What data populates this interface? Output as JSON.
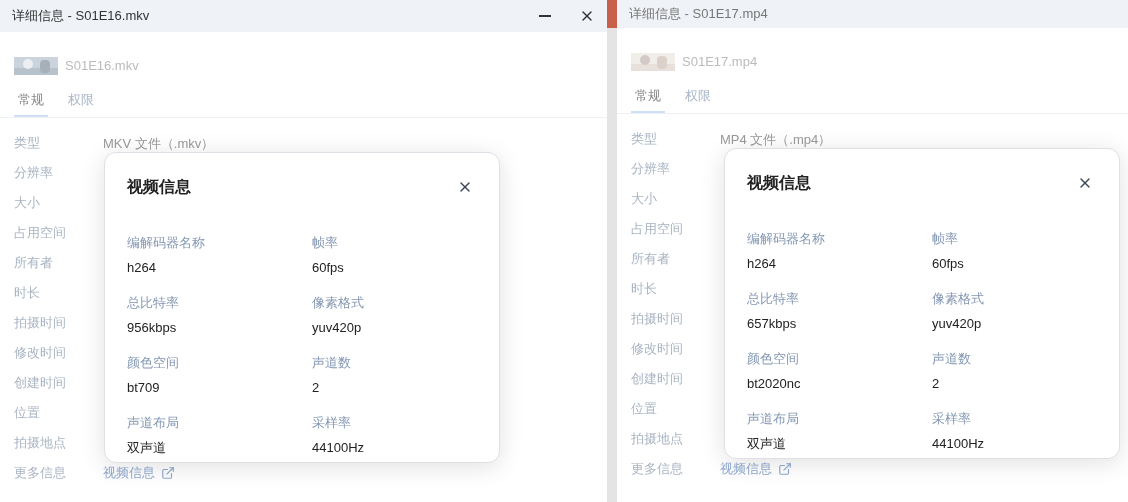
{
  "windows": [
    {
      "title": "详细信息 - S01E16.mkv",
      "window_controls": true,
      "file_name": "S01E16.mkv",
      "tabs": [
        {
          "label": "常规",
          "selected": true
        },
        {
          "label": "权限",
          "selected": false
        }
      ],
      "properties": [
        {
          "label": "类型",
          "value": "MKV 文件（.mkv）"
        },
        {
          "label": "分辨率"
        },
        {
          "label": "大小"
        },
        {
          "label": "占用空间"
        },
        {
          "label": "所有者"
        },
        {
          "label": "时长"
        },
        {
          "label": "拍摄时间"
        },
        {
          "label": "修改时间"
        },
        {
          "label": "创建时间"
        },
        {
          "label": "位置"
        },
        {
          "label": "拍摄地点"
        },
        {
          "label": "更多信息",
          "link": "视频信息"
        }
      ],
      "dialog": {
        "title": "视频信息",
        "fields": [
          {
            "label": "编解码器名称",
            "value": "h264"
          },
          {
            "label": "帧率",
            "value": "60fps"
          },
          {
            "label": "总比特率",
            "value": "956kbps"
          },
          {
            "label": "像素格式",
            "value": "yuv420p"
          },
          {
            "label": "颜色空间",
            "value": "bt709"
          },
          {
            "label": "声道数",
            "value": "2"
          },
          {
            "label": "声道布局",
            "value": "双声道"
          },
          {
            "label": "采样率",
            "value": "44100Hz"
          }
        ]
      }
    },
    {
      "title": "详细信息 - S01E17.mp4",
      "window_controls": false,
      "file_name": "S01E17.mp4",
      "tabs": [
        {
          "label": "常规",
          "selected": true
        },
        {
          "label": "权限",
          "selected": false
        }
      ],
      "properties": [
        {
          "label": "类型",
          "value": "MP4 文件（.mp4）"
        },
        {
          "label": "分辨率"
        },
        {
          "label": "大小"
        },
        {
          "label": "占用空间"
        },
        {
          "label": "所有者"
        },
        {
          "label": "时长"
        },
        {
          "label": "拍摄时间"
        },
        {
          "label": "修改时间"
        },
        {
          "label": "创建时间"
        },
        {
          "label": "位置"
        },
        {
          "label": "拍摄地点"
        },
        {
          "label": "更多信息",
          "link": "视频信息"
        }
      ],
      "dialog": {
        "title": "视频信息",
        "fields": [
          {
            "label": "编解码器名称",
            "value": "h264"
          },
          {
            "label": "帧率",
            "value": "60fps"
          },
          {
            "label": "总比特率",
            "value": "657kbps"
          },
          {
            "label": "像素格式",
            "value": "yuv420p"
          },
          {
            "label": "颜色空间",
            "value": "bt2020nc"
          },
          {
            "label": "声道数",
            "value": "2"
          },
          {
            "label": "声道布局",
            "value": "双声道"
          },
          {
            "label": "采样率",
            "value": "44100Hz"
          }
        ]
      }
    }
  ]
}
